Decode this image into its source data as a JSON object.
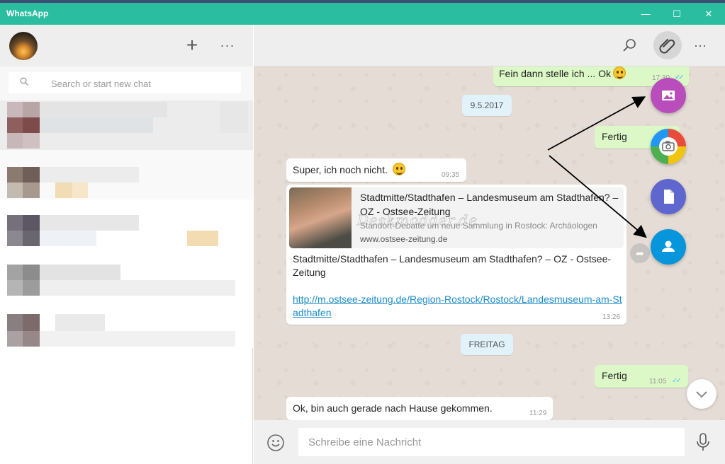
{
  "window": {
    "title": "WhatsApp",
    "controls": {
      "minimize": "—",
      "maximize": "☐",
      "close": "✕"
    }
  },
  "sidebar": {
    "new_chat_icon": "plus-icon",
    "menu_icon": "more-dots-icon",
    "search": {
      "placeholder": "Search or start new chat",
      "icon": "search-icon"
    }
  },
  "chat": {
    "header": {
      "search_icon": "search-icon",
      "attach_icon": "paperclip-icon",
      "menu_icon": "more-dots-icon"
    },
    "messages": [
      {
        "direction": "out",
        "text": "Fein dann stelle ich ... Ok",
        "time": "17:30"
      },
      {
        "type": "date",
        "text": "9.5.2017"
      },
      {
        "direction": "out",
        "text": "Fertig"
      },
      {
        "direction": "in",
        "text": "Super, ich noch nicht.",
        "time": "09:35"
      },
      {
        "direction": "in",
        "time": "13:26",
        "preview": {
          "title": "Stadtmitte/Stadthafen – Landesmuseum am Stadthafen? – OZ - Ostsee-Zeitung",
          "description": "Standort-Debatte um neue Sammlung in Rostock: Archäologen",
          "domain": "www.ostsee-zeitung.de"
        },
        "text": "Stadtmitte/Stadthafen – Landesmuseum am Stadthafen? – OZ - Ostsee-Zeitung",
        "link": "http://m.ostsee-zeitung.de/Region-Rostock/Rostock/Landesmuseum-am-Stadthafen"
      },
      {
        "type": "date",
        "text": "FREITAG"
      },
      {
        "direction": "out",
        "text": "Fertig",
        "time": "11:05"
      },
      {
        "direction": "in",
        "text": "Ok, bin auch gerade nach Hause gekommen.",
        "time": "11:29"
      }
    ],
    "watermark": "Deskmodder.de",
    "attach_menu": [
      "gallery-icon",
      "camera-icon",
      "document-icon",
      "contact-icon"
    ],
    "composer": {
      "placeholder": "Schreibe eine Nachricht",
      "emoji_icon": "smiley-icon",
      "mic_icon": "microphone-icon"
    }
  },
  "colors": {
    "titlebar": "#2bbd9f",
    "outgoing_bubble": "#dcf8c6",
    "incoming_bubble": "#ffffff",
    "chat_background": "#e5ddd5",
    "link": "#1a8cc7",
    "fab_gallery": "#b94dbb",
    "fab_document": "#5f66cd",
    "fab_contact": "#0795dc"
  }
}
